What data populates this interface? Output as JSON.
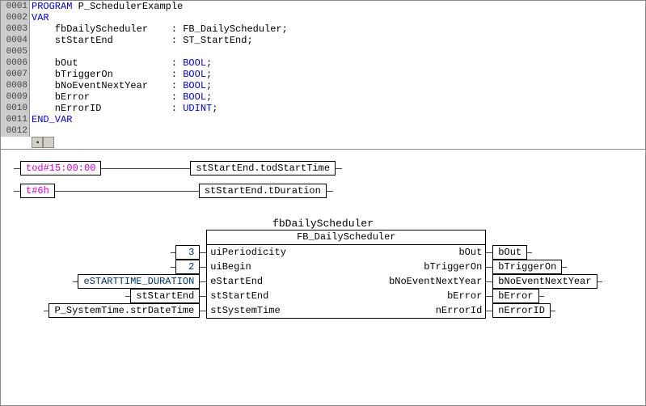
{
  "code": {
    "lines": [
      {
        "n": "0001",
        "pre": "",
        "kw": "PROGRAM",
        "rest": " P_SchedulerExample"
      },
      {
        "n": "0002",
        "pre": "",
        "kw": "VAR",
        "rest": ""
      },
      {
        "n": "0003",
        "pre": "    fbDailyScheduler    : FB_DailyScheduler;",
        "kw": "",
        "rest": ""
      },
      {
        "n": "0004",
        "pre": "    stStartEnd          : ST_StartEnd;",
        "kw": "",
        "rest": ""
      },
      {
        "n": "0005",
        "pre": "",
        "kw": "",
        "rest": ""
      },
      {
        "n": "0006",
        "pre": "    bOut                : ",
        "kw": "BOOL",
        "rest": ";"
      },
      {
        "n": "0007",
        "pre": "    bTriggerOn          : ",
        "kw": "BOOL",
        "rest": ";"
      },
      {
        "n": "0008",
        "pre": "    bNoEventNextYear    : ",
        "kw": "BOOL",
        "rest": ";"
      },
      {
        "n": "0009",
        "pre": "    bError              : ",
        "kw": "BOOL",
        "rest": ";"
      },
      {
        "n": "0010",
        "pre": "    nErrorID            : ",
        "kw": "UDINT",
        "rest": ";"
      },
      {
        "n": "0011",
        "pre": "",
        "kw": "END_VAR",
        "rest": ""
      },
      {
        "n": "0012",
        "pre": "",
        "kw": "",
        "rest": ""
      }
    ]
  },
  "assigns": [
    {
      "lhs": "tod#15:00:00",
      "rhs": "stStartEnd.todStartTime",
      "lhsClass": "magenta"
    },
    {
      "lhs": "t#6h",
      "rhs": "stStartEnd.tDuration",
      "lhsClass": "magenta"
    }
  ],
  "fb": {
    "instance": "fbDailyScheduler",
    "type": "FB_DailyScheduler",
    "inputs": [
      {
        "ext": "3",
        "port": "uiPeriodicity",
        "extClass": "dark"
      },
      {
        "ext": "2",
        "port": "uiBegin",
        "extClass": "dark"
      },
      {
        "ext": "eSTARTTIME_DURATION",
        "port": "eStartEnd",
        "extClass": "dark"
      },
      {
        "ext": "stStartEnd",
        "port": "stStartEnd",
        "extClass": "plain"
      },
      {
        "ext": "P_SystemTime.strDateTime",
        "port": "stSystemTime",
        "extClass": "plain"
      }
    ],
    "outputs": [
      {
        "port": "bOut",
        "ext": "bOut"
      },
      {
        "port": "bTriggerOn",
        "ext": "bTriggerOn"
      },
      {
        "port": "bNoEventNextYear",
        "ext": "bNoEventNextYear"
      },
      {
        "port": "bError",
        "ext": "bError"
      },
      {
        "port": "nErrorId",
        "ext": "nErrorID"
      }
    ]
  }
}
